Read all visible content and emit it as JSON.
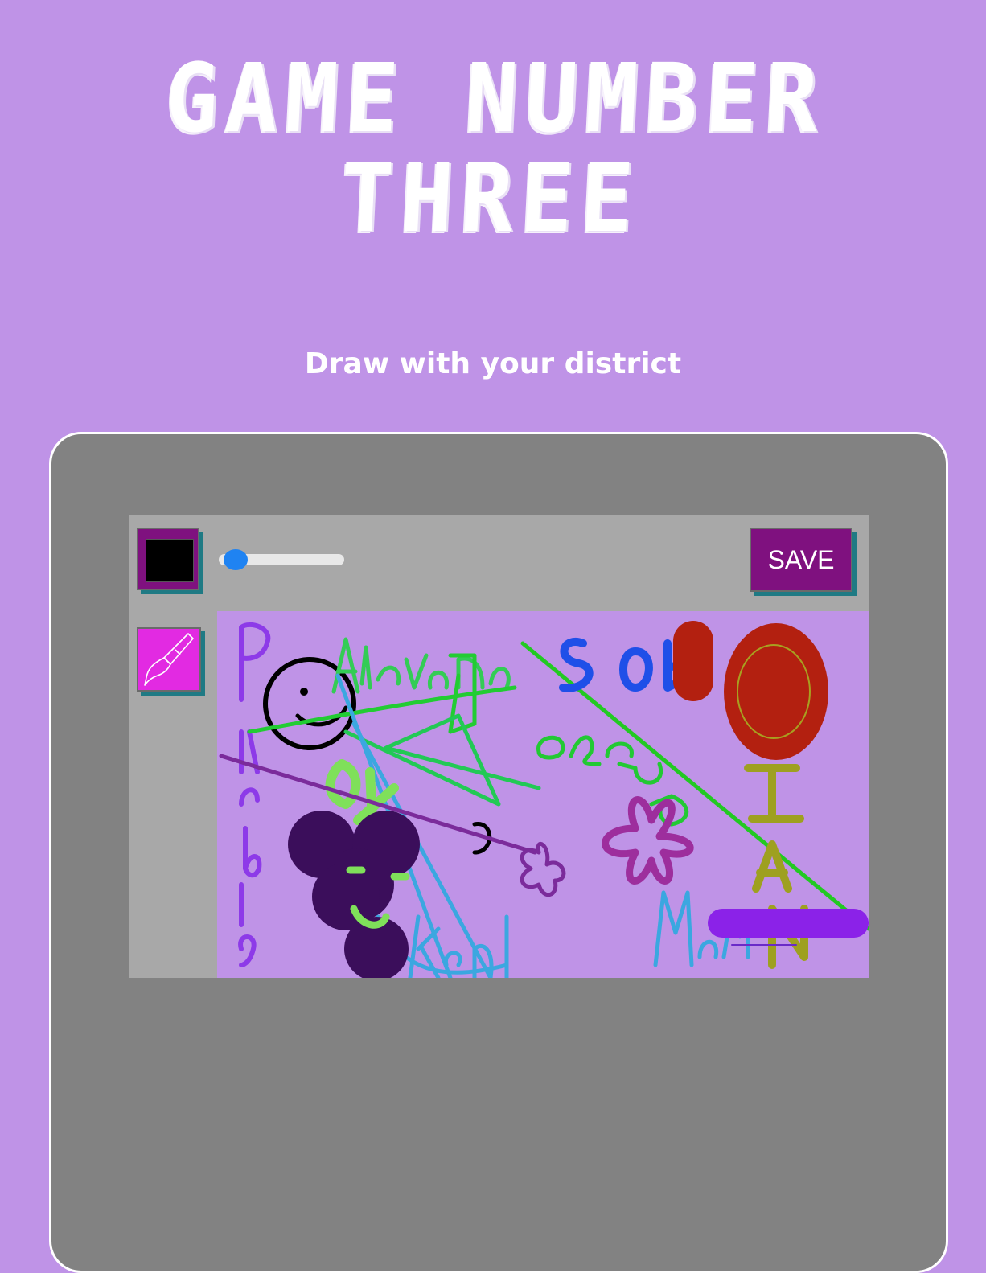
{
  "page": {
    "title_line1": "GAME NUMBER",
    "title_line2": "THREE",
    "subtitle": "Draw with your district"
  },
  "toolbar": {
    "current_color": "#000000",
    "brush_size_fraction": 0.05,
    "save_label": "SAVE",
    "brush_tool_icon": "paintbrush-icon"
  },
  "canvas": {
    "background": "#bf93e7",
    "handwritten_words": [
      "Purple",
      "Aalayna",
      "SOL",
      "Rose",
      "IAN",
      "Marin",
      "OY",
      "Kenh"
    ]
  },
  "colors": {
    "page_bg": "#bf93e7",
    "panel_bg": "#828282",
    "toolbar_bg": "#a8a8a8",
    "button_bg": "#7f117f",
    "button_shadow": "#1f7a84",
    "brush_button_bg": "#e22ae2",
    "slider_knob": "#1f83f2"
  }
}
